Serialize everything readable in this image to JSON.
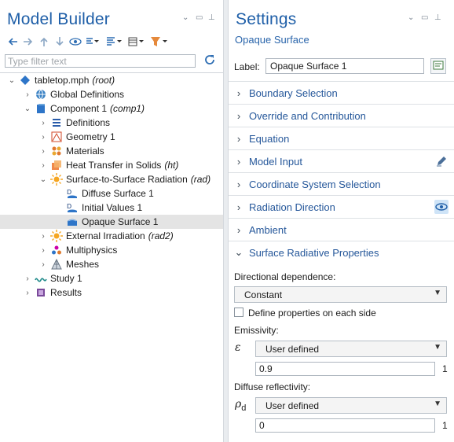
{
  "model_builder": {
    "title": "Model Builder",
    "filter_placeholder": "Type filter text",
    "tree": [
      {
        "label": "tabletop.mph",
        "tag": "(root)",
        "icon": "file-icon",
        "expanded": true,
        "level": 0
      },
      {
        "label": "Global Definitions",
        "tag": "",
        "icon": "globe-icon",
        "expanded": false,
        "level": 1
      },
      {
        "label": "Component 1",
        "tag": "(comp1)",
        "icon": "component-icon",
        "expanded": true,
        "level": 1
      },
      {
        "label": "Definitions",
        "tag": "",
        "icon": "definitions-icon",
        "expanded": false,
        "level": 2
      },
      {
        "label": "Geometry 1",
        "tag": "",
        "icon": "geometry-icon",
        "expanded": false,
        "level": 2
      },
      {
        "label": "Materials",
        "tag": "",
        "icon": "materials-icon",
        "expanded": false,
        "level": 2
      },
      {
        "label": "Heat Transfer in Solids",
        "tag": "(ht)",
        "icon": "heat-transfer-icon",
        "expanded": false,
        "level": 2
      },
      {
        "label": "Surface-to-Surface Radiation",
        "tag": "(rad)",
        "icon": "radiation-icon",
        "expanded": true,
        "level": 2
      },
      {
        "label": "Diffuse Surface 1",
        "tag": "",
        "icon": "diffuse-surface-icon",
        "level": 3
      },
      {
        "label": "Initial Values 1",
        "tag": "",
        "icon": "initial-values-icon",
        "level": 3
      },
      {
        "label": "Opaque Surface 1",
        "tag": "",
        "icon": "opaque-surface-icon",
        "level": 3,
        "selected": true
      },
      {
        "label": "External Irradiation",
        "tag": "(rad2)",
        "icon": "irradiation-icon",
        "expanded": false,
        "level": 2
      },
      {
        "label": "Multiphysics",
        "tag": "",
        "icon": "multiphysics-icon",
        "expanded": false,
        "level": 2
      },
      {
        "label": "Meshes",
        "tag": "",
        "icon": "mesh-icon",
        "expanded": false,
        "level": 2
      },
      {
        "label": "Study 1",
        "tag": "",
        "icon": "study-icon",
        "expanded": false,
        "level": 1
      },
      {
        "label": "Results",
        "tag": "",
        "icon": "results-icon",
        "expanded": false,
        "level": 1
      }
    ]
  },
  "settings": {
    "title": "Settings",
    "subtitle": "Opaque Surface",
    "label_caption": "Label:",
    "label_value": "Opaque Surface 1",
    "sections": [
      {
        "label": "Boundary Selection",
        "expanded": false
      },
      {
        "label": "Override and Contribution",
        "expanded": false
      },
      {
        "label": "Equation",
        "expanded": false
      },
      {
        "label": "Model Input",
        "expanded": false,
        "button": "pencil-icon"
      },
      {
        "label": "Coordinate System Selection",
        "expanded": false
      },
      {
        "label": "Radiation Direction",
        "expanded": false,
        "button": "eye-icon"
      },
      {
        "label": "Ambient",
        "expanded": false
      },
      {
        "label": "Surface Radiative Properties",
        "expanded": true
      }
    ],
    "surface_props": {
      "directional_label": "Directional dependence:",
      "directional_value": "Constant",
      "define_each_side_label": "Define properties on each side",
      "define_each_side_checked": false,
      "emissivity_label": "Emissivity:",
      "emissivity_symbol": "ε",
      "emissivity_mode": "User defined",
      "emissivity_value": "0.9",
      "emissivity_unit": "1",
      "diffuse_label": "Diffuse reflectivity:",
      "diffuse_symbol": "ρ",
      "diffuse_symbol_sub": "d",
      "diffuse_mode": "User defined",
      "diffuse_value": "0",
      "diffuse_unit": "1"
    }
  },
  "colors": {
    "title": "#1f5fa8",
    "section_text": "#25579a",
    "selected_row": "#e4e4e4"
  }
}
